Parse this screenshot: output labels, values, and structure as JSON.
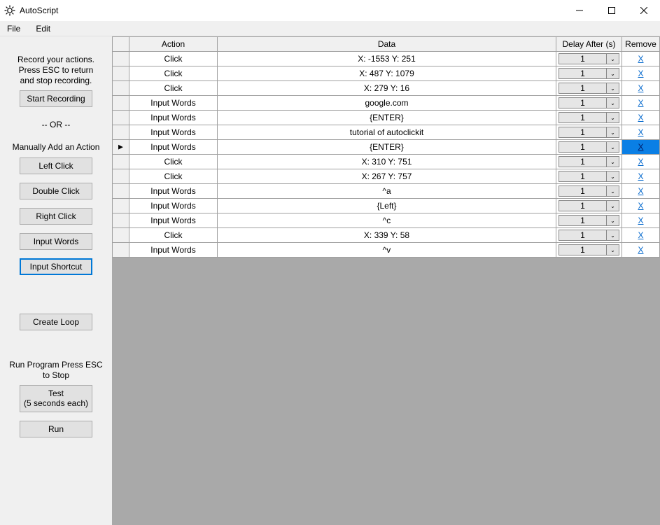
{
  "window": {
    "title": "AutoScript"
  },
  "menubar": {
    "file": "File",
    "edit": "Edit"
  },
  "sidebar": {
    "record_help": "Record your actions.\nPress ESC to return\nand stop recording.",
    "start_recording": "Start Recording",
    "or": "-- OR --",
    "manual_label": "Manually Add an Action",
    "left_click": "Left Click",
    "double_click": "Double Click",
    "right_click": "Right Click",
    "input_words": "Input Words",
    "input_shortcut": "Input Shortcut",
    "create_loop": "Create Loop",
    "run_help": "Run Program\nPress ESC to Stop",
    "test": "Test\n(5 seconds each)",
    "run": "Run"
  },
  "grid": {
    "headers": {
      "action": "Action",
      "data": "Data",
      "delay": "Delay After (s)",
      "remove": "Remove"
    },
    "remove_label": "X",
    "rows": [
      {
        "action": "Click",
        "data": "X: -1553 Y: 251",
        "delay": "1",
        "current": false,
        "remove_selected": false
      },
      {
        "action": "Click",
        "data": "X: 487 Y: 1079",
        "delay": "1",
        "current": false,
        "remove_selected": false
      },
      {
        "action": "Click",
        "data": "X: 279 Y: 16",
        "delay": "1",
        "current": false,
        "remove_selected": false
      },
      {
        "action": "Input Words",
        "data": "google.com",
        "delay": "1",
        "current": false,
        "remove_selected": false
      },
      {
        "action": "Input Words",
        "data": "{ENTER}",
        "delay": "1",
        "current": false,
        "remove_selected": false
      },
      {
        "action": "Input Words",
        "data": "tutorial of autoclickit",
        "delay": "1",
        "current": false,
        "remove_selected": false
      },
      {
        "action": "Input Words",
        "data": "{ENTER}",
        "delay": "1",
        "current": true,
        "remove_selected": true
      },
      {
        "action": "Click",
        "data": "X: 310 Y: 751",
        "delay": "1",
        "current": false,
        "remove_selected": false
      },
      {
        "action": "Click",
        "data": "X: 267 Y: 757",
        "delay": "1",
        "current": false,
        "remove_selected": false
      },
      {
        "action": "Input Words",
        "data": "^a",
        "delay": "1",
        "current": false,
        "remove_selected": false
      },
      {
        "action": "Input Words",
        "data": "{Left}",
        "delay": "1",
        "current": false,
        "remove_selected": false
      },
      {
        "action": "Input Words",
        "data": "^c",
        "delay": "1",
        "current": false,
        "remove_selected": false
      },
      {
        "action": "Click",
        "data": "X: 339 Y: 58",
        "delay": "1",
        "current": false,
        "remove_selected": false
      },
      {
        "action": "Input Words",
        "data": "^v",
        "delay": "1",
        "current": false,
        "remove_selected": false
      }
    ]
  }
}
